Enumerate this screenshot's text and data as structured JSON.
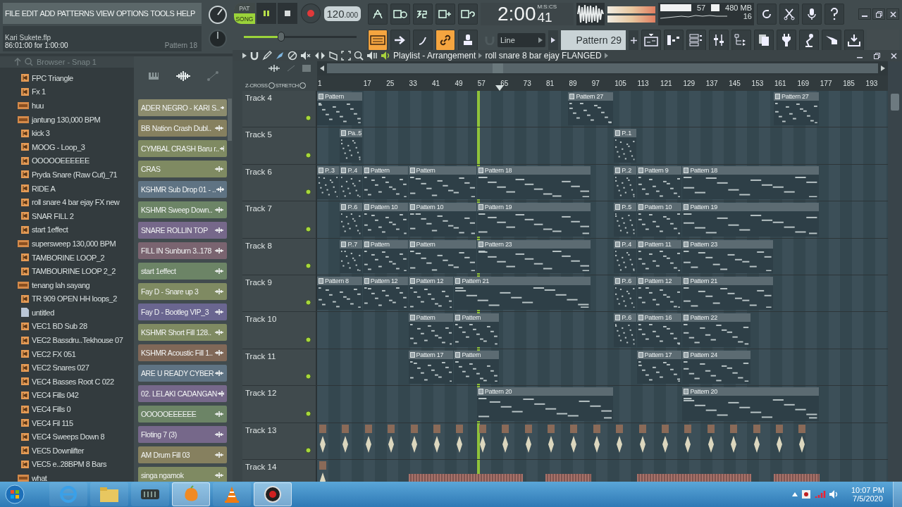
{
  "menu": [
    "FILE",
    "EDIT",
    "ADD",
    "PATTERNS",
    "VIEW",
    "OPTIONS",
    "TOOLS",
    "HELP"
  ],
  "transport": {
    "modes": [
      {
        "label": "PAT",
        "selected": false
      },
      {
        "label": "SONG",
        "selected": true
      }
    ],
    "playing": true,
    "tempo_int": "120",
    "tempo_frac": ".000",
    "time_main": "2:00",
    "time_cs": "41",
    "time_unit": "M:S:CS",
    "cpu": "57",
    "memory": "480 MB",
    "polyphony": "16",
    "master_volume": {
      "level": 0.33
    }
  },
  "project": {
    "file": "Kari Sukete.flp",
    "position": "86:01:00 for 1:00:00",
    "pattern": "Pattern 18"
  },
  "snap": "Line",
  "current_pattern": "Pattern 29",
  "browser": {
    "title": "Browser - Snap 1",
    "items": [
      {
        "kind": "sample",
        "name": "FPC Triangle"
      },
      {
        "kind": "sample",
        "name": "Fx 1"
      },
      {
        "kind": "mp3",
        "name": "huu"
      },
      {
        "kind": "mp3",
        "name": "jantung 130,000 BPM"
      },
      {
        "kind": "sample",
        "name": "kick 3"
      },
      {
        "kind": "sample",
        "name": "MOOG - Loop_3"
      },
      {
        "kind": "sample",
        "name": "OOOOOEEEEEE"
      },
      {
        "kind": "sample",
        "name": "Pryda Snare (Raw Cut)_71"
      },
      {
        "kind": "sample",
        "name": "RIDE A"
      },
      {
        "kind": "sample",
        "name": "roll snare 4 bar ejay FX new"
      },
      {
        "kind": "sample",
        "name": "SNAR FILL 2"
      },
      {
        "kind": "sample",
        "name": "start 1effect"
      },
      {
        "kind": "mp3",
        "name": "supersweep 130,000 BPM"
      },
      {
        "kind": "sample",
        "name": "TAMBORINE LOOP_2"
      },
      {
        "kind": "sample",
        "name": "TAMBOURINE LOOP 2_2"
      },
      {
        "kind": "mp3",
        "name": "tenang lah sayang"
      },
      {
        "kind": "sample",
        "name": "TR 909 OPEN HH loops_2"
      },
      {
        "kind": "file",
        "name": "untitled"
      },
      {
        "kind": "sample",
        "name": "VEC1 BD Sub 28"
      },
      {
        "kind": "sample",
        "name": "VEC2 Bassdru..Tekhouse 07"
      },
      {
        "kind": "sample",
        "name": "VEC2 FX 051"
      },
      {
        "kind": "sample",
        "name": "VEC2 Snares 027"
      },
      {
        "kind": "sample",
        "name": "VEC4 Basses Root C 022"
      },
      {
        "kind": "sample",
        "name": "VEC4 Fills 042"
      },
      {
        "kind": "sample",
        "name": "VEC4 Fills 0"
      },
      {
        "kind": "sample",
        "name": "VEC4 Fil 115"
      },
      {
        "kind": "sample",
        "name": "VEC4 Sweeps Down 8"
      },
      {
        "kind": "sample",
        "name": "VEC5 Downlifter"
      },
      {
        "kind": "sample",
        "name": "VEC5 e..28BPM 8 Bars"
      },
      {
        "kind": "mp3",
        "name": "what"
      }
    ]
  },
  "channels": [
    {
      "name": "ADER NEGRO - KARI S..",
      "color": "#8c8c6e"
    },
    {
      "name": "BB Nation Crash Dubl..",
      "color": "#86805f"
    },
    {
      "name": "CYMBAL CRASH Baru r..",
      "color": "#7f8a62"
    },
    {
      "name": "CRAS",
      "color": "#7f8a62"
    },
    {
      "name": "KSHMR Sub Drop 01 - ..",
      "color": "#5f7383"
    },
    {
      "name": "KSHMR Sweep Down..",
      "color": "#6c8466"
    },
    {
      "name": "SNARE ROLLIN TOP",
      "color": "#76688a"
    },
    {
      "name": "FILL IN Sunburn 3..178",
      "color": "#7a6470"
    },
    {
      "name": "start 1effect",
      "color": "#6c8466"
    },
    {
      "name": "Fay D - Snare up 3",
      "color": "#7f8a62"
    },
    {
      "name": "Fay D - Bootleg VIP_3",
      "color": "#6a6690"
    },
    {
      "name": "KSHMR Short Fill 128..",
      "color": "#7f8a62"
    },
    {
      "name": "KSHMR Acoustic Fill 1..",
      "color": "#806858"
    },
    {
      "name": "ARE U READY CYBER",
      "color": "#5f7383"
    },
    {
      "name": "02. LELAKI CADANGAN",
      "color": "#76688a"
    },
    {
      "name": "OOOOOEEEEEE",
      "color": "#6c8466"
    },
    {
      "name": "Floting 7  (3)",
      "color": "#76688a"
    },
    {
      "name": "AM Drum Fill 03",
      "color": "#86805f"
    },
    {
      "name": "singa ngamok",
      "color": "#7f8a62"
    }
  ],
  "playlist": {
    "title": "Playlist - Arrangement",
    "pattern": "roll snare 8 bar ejay FLANGED",
    "options": [
      {
        "label": "Z-CROSS",
        "checked": false
      },
      {
        "label": "STRETCH",
        "checked": false
      }
    ],
    "ruler": [
      {
        "label": "1",
        "playhead": false
      },
      {
        "playhead": false
      },
      {
        "label": "17",
        "playhead": false
      },
      {
        "label": "25",
        "playhead": false
      },
      {
        "label": "33",
        "playhead": false
      },
      {
        "label": "41",
        "playhead": false
      },
      {
        "label": "49",
        "playhead": false
      },
      {
        "label": "57",
        "playhead": true
      },
      {
        "label": "65",
        "playhead": false
      },
      {
        "label": "73",
        "playhead": false
      },
      {
        "label": "81",
        "playhead": false
      },
      {
        "label": "89",
        "playhead": false
      },
      {
        "label": "97",
        "playhead": false
      },
      {
        "label": "105",
        "playhead": false
      },
      {
        "label": "113",
        "playhead": false
      },
      {
        "label": "121",
        "playhead": false
      },
      {
        "label": "129",
        "playhead": false
      },
      {
        "label": "137",
        "playhead": false
      },
      {
        "label": "145",
        "playhead": false
      },
      {
        "label": "153",
        "playhead": false
      },
      {
        "label": "161",
        "playhead": false
      },
      {
        "label": "169",
        "playhead": false
      },
      {
        "label": "177",
        "playhead": false
      },
      {
        "label": "185",
        "playhead": false
      },
      {
        "label": "193",
        "playhead": false
      }
    ],
    "tracks": [
      {
        "name": "Track 4",
        "lane": [
          {
            "kind": "clip",
            "label": "Pattern"
          },
          {
            "kind": "cont"
          },
          {
            "kind": "empty"
          },
          {
            "kind": "empty"
          },
          {
            "kind": "empty"
          },
          {
            "kind": "empty"
          },
          {
            "kind": "empty"
          },
          {
            "kind": "empty"
          },
          {
            "kind": "empty"
          },
          {
            "kind": "empty"
          },
          {
            "kind": "empty"
          },
          {
            "kind": "clip",
            "label": "Pattern 27"
          },
          {
            "kind": "cont"
          },
          {
            "kind": "empty"
          },
          {
            "kind": "empty"
          },
          {
            "kind": "empty"
          },
          {
            "kind": "empty"
          },
          {
            "kind": "empty"
          },
          {
            "kind": "empty"
          },
          {
            "kind": "empty"
          },
          {
            "kind": "clip",
            "label": "Pattern 27"
          },
          {
            "kind": "cont"
          }
        ]
      },
      {
        "name": "Track 5",
        "lane": [
          {
            "kind": "empty"
          },
          {
            "kind": "clip",
            "label": "Pa..5"
          },
          {
            "kind": "empty"
          },
          {
            "kind": "empty"
          },
          {
            "kind": "empty"
          },
          {
            "kind": "empty"
          },
          {
            "kind": "empty"
          },
          {
            "kind": "empty"
          },
          {
            "kind": "empty"
          },
          {
            "kind": "empty"
          },
          {
            "kind": "empty"
          },
          {
            "kind": "empty"
          },
          {
            "kind": "empty"
          },
          {
            "kind": "clip",
            "label": "P..1"
          }
        ]
      },
      {
        "name": "Track 6",
        "lane": [
          {
            "kind": "clip",
            "label": "P..3"
          },
          {
            "kind": "clip",
            "label": "P..4"
          },
          {
            "kind": "clip",
            "label": "Pattern"
          },
          {
            "kind": "cont"
          },
          {
            "kind": "clip",
            "label": "Pattern"
          },
          {
            "kind": "cont"
          },
          {
            "kind": "cont"
          },
          {
            "kind": "clip",
            "label": "Pattern 18"
          },
          {
            "kind": "cont"
          },
          {
            "kind": "cont"
          },
          {
            "kind": "cont"
          },
          {
            "kind": "cont"
          },
          {
            "kind": "empty"
          },
          {
            "kind": "clip",
            "label": "P..2"
          },
          {
            "kind": "clip",
            "label": "Pattern 9"
          },
          {
            "kind": "cont"
          },
          {
            "kind": "clip",
            "label": "Pattern 18"
          },
          {
            "kind": "cont"
          },
          {
            "kind": "cont"
          },
          {
            "kind": "cont"
          },
          {
            "kind": "cont"
          },
          {
            "kind": "cont"
          }
        ]
      },
      {
        "name": "Track 7",
        "lane": [
          {
            "kind": "empty"
          },
          {
            "kind": "clip",
            "label": "P..6"
          },
          {
            "kind": "clip",
            "label": "Pattern 10"
          },
          {
            "kind": "cont"
          },
          {
            "kind": "clip",
            "label": "Pattern 10"
          },
          {
            "kind": "cont"
          },
          {
            "kind": "cont"
          },
          {
            "kind": "clip",
            "label": "Pattern 19"
          },
          {
            "kind": "cont"
          },
          {
            "kind": "cont"
          },
          {
            "kind": "cont"
          },
          {
            "kind": "cont"
          },
          {
            "kind": "empty"
          },
          {
            "kind": "clip",
            "label": "P..5"
          },
          {
            "kind": "clip",
            "label": "Pattern 10"
          },
          {
            "kind": "cont"
          },
          {
            "kind": "clip",
            "label": "Pattern 19"
          },
          {
            "kind": "cont"
          },
          {
            "kind": "cont"
          },
          {
            "kind": "cont"
          },
          {
            "kind": "cont"
          },
          {
            "kind": "cont"
          }
        ]
      },
      {
        "name": "Track 8",
        "lane": [
          {
            "kind": "empty"
          },
          {
            "kind": "clip",
            "label": "P..7"
          },
          {
            "kind": "clip",
            "label": "Pattern"
          },
          {
            "kind": "cont"
          },
          {
            "kind": "clip",
            "label": "Pattern"
          },
          {
            "kind": "cont"
          },
          {
            "kind": "cont"
          },
          {
            "kind": "clip",
            "label": "Pattern 23"
          },
          {
            "kind": "cont"
          },
          {
            "kind": "cont"
          },
          {
            "kind": "cont"
          },
          {
            "kind": "cont"
          },
          {
            "kind": "empty"
          },
          {
            "kind": "clip",
            "label": "P..4"
          },
          {
            "kind": "clip",
            "label": "Pattern 11"
          },
          {
            "kind": "cont"
          },
          {
            "kind": "clip",
            "label": "Pattern 23"
          },
          {
            "kind": "cont"
          },
          {
            "kind": "cont"
          },
          {
            "kind": "cont"
          }
        ]
      },
      {
        "name": "Track 9",
        "lane": [
          {
            "kind": "clip",
            "label": "Pattern 8"
          },
          {
            "kind": "cont"
          },
          {
            "kind": "clip",
            "label": "Pattern 12"
          },
          {
            "kind": "cont"
          },
          {
            "kind": "clip",
            "label": "Pattern 12"
          },
          {
            "kind": "cont"
          },
          {
            "kind": "clip",
            "label": "Pattern 21"
          },
          {
            "kind": "cont"
          },
          {
            "kind": "cont"
          },
          {
            "kind": "cont"
          },
          {
            "kind": "cont"
          },
          {
            "kind": "cont"
          },
          {
            "kind": "empty"
          },
          {
            "kind": "clip",
            "label": "P..6"
          },
          {
            "kind": "clip",
            "label": "Pattern 12"
          },
          {
            "kind": "cont"
          },
          {
            "kind": "clip",
            "label": "Pattern 21"
          },
          {
            "kind": "cont"
          },
          {
            "kind": "cont"
          },
          {
            "kind": "cont"
          }
        ]
      },
      {
        "name": "Track 10",
        "lane": [
          {
            "kind": "empty"
          },
          {
            "kind": "empty"
          },
          {
            "kind": "empty"
          },
          {
            "kind": "empty"
          },
          {
            "kind": "clip",
            "label": "Pattern"
          },
          {
            "kind": "cont"
          },
          {
            "kind": "clip",
            "label": "Pattern"
          },
          {
            "kind": "cont"
          },
          {
            "kind": "empty"
          },
          {
            "kind": "empty"
          },
          {
            "kind": "empty"
          },
          {
            "kind": "empty"
          },
          {
            "kind": "empty"
          },
          {
            "kind": "clip",
            "label": "P..6"
          },
          {
            "kind": "clip",
            "label": "Pattern 16"
          },
          {
            "kind": "cont"
          },
          {
            "kind": "clip",
            "label": "Pattern 22"
          },
          {
            "kind": "cont"
          },
          {
            "kind": "cont"
          }
        ]
      },
      {
        "name": "Track 11",
        "lane": [
          {
            "kind": "empty"
          },
          {
            "kind": "empty"
          },
          {
            "kind": "empty"
          },
          {
            "kind": "empty"
          },
          {
            "kind": "clip",
            "label": "Pattern 17"
          },
          {
            "kind": "cont"
          },
          {
            "kind": "clip",
            "label": "Pattern"
          },
          {
            "kind": "cont"
          },
          {
            "kind": "empty"
          },
          {
            "kind": "empty"
          },
          {
            "kind": "empty"
          },
          {
            "kind": "empty"
          },
          {
            "kind": "empty"
          },
          {
            "kind": "empty"
          },
          {
            "kind": "clip",
            "label": "Pattern 17"
          },
          {
            "kind": "cont"
          },
          {
            "kind": "clip",
            "label": "Pattern 24"
          },
          {
            "kind": "cont"
          },
          {
            "kind": "cont"
          }
        ]
      },
      {
        "name": "Track 12",
        "lane": [
          {
            "kind": "empty"
          },
          {
            "kind": "empty"
          },
          {
            "kind": "empty"
          },
          {
            "kind": "empty"
          },
          {
            "kind": "empty"
          },
          {
            "kind": "empty"
          },
          {
            "kind": "empty"
          },
          {
            "kind": "clip",
            "label": "Pattern 20"
          },
          {
            "kind": "cont"
          },
          {
            "kind": "cont"
          },
          {
            "kind": "cont"
          },
          {
            "kind": "cont"
          },
          {
            "kind": "cont"
          },
          {
            "kind": "empty"
          },
          {
            "kind": "empty"
          },
          {
            "kind": "empty"
          },
          {
            "kind": "clip",
            "label": "Pattern 20"
          },
          {
            "kind": "cont"
          },
          {
            "kind": "cont"
          },
          {
            "kind": "cont"
          },
          {
            "kind": "cont"
          },
          {
            "kind": "cont"
          }
        ]
      },
      {
        "name": "Track 13",
        "lane": [
          {
            "kind": "hit"
          },
          {
            "kind": "hit"
          },
          {
            "kind": "hit"
          },
          {
            "kind": "hit"
          },
          {
            "kind": "hit"
          },
          {
            "kind": "hit"
          },
          {
            "kind": "hit"
          },
          {
            "kind": "hit"
          },
          {
            "kind": "hit"
          },
          {
            "kind": "hit"
          },
          {
            "kind": "hit"
          },
          {
            "kind": "hit"
          },
          {
            "kind": "hit"
          },
          {
            "kind": "hit"
          },
          {
            "kind": "hit"
          },
          {
            "kind": "hit"
          },
          {
            "kind": "hit"
          },
          {
            "kind": "hit"
          },
          {
            "kind": "hit"
          },
          {
            "kind": "hit"
          },
          {
            "kind": "hit"
          },
          {
            "kind": "hit"
          }
        ]
      },
      {
        "name": "Track 14",
        "lane": [
          {
            "kind": "hit"
          },
          {
            "kind": "empty"
          },
          {
            "kind": "empty"
          },
          {
            "kind": "empty"
          },
          {
            "kind": "audio"
          },
          {
            "kind": "cont"
          },
          {
            "kind": "cont"
          },
          {
            "kind": "cont"
          },
          {
            "kind": "cont"
          },
          {
            "kind": "empty"
          },
          {
            "kind": "audio"
          },
          {
            "kind": "cont"
          },
          {
            "kind": "empty"
          },
          {
            "kind": "empty"
          },
          {
            "kind": "audio"
          },
          {
            "kind": "cont"
          },
          {
            "kind": "cont"
          },
          {
            "kind": "cont"
          },
          {
            "kind": "cont"
          },
          {
            "kind": "empty"
          },
          {
            "kind": "audio"
          },
          {
            "kind": "cont"
          }
        ]
      }
    ]
  },
  "taskbar": {
    "time": "10:07 PM",
    "date": "7/5/2020"
  }
}
